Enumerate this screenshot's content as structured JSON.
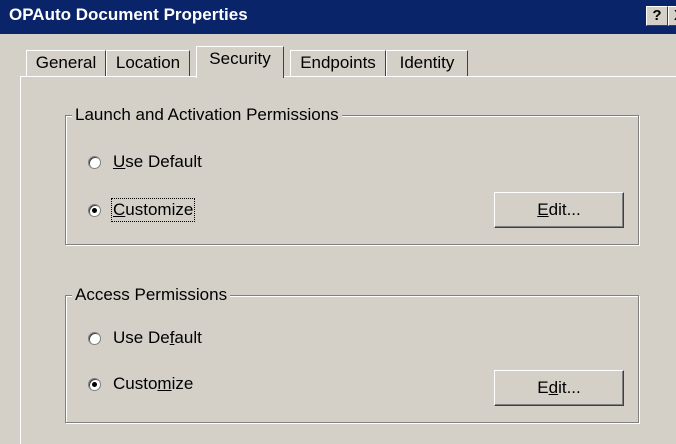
{
  "window": {
    "title": "OPAuto Document Properties",
    "help_glyph": "?",
    "close_glyph": "X"
  },
  "tabs": [
    {
      "label": "General"
    },
    {
      "label": "Location"
    },
    {
      "label": "Security",
      "active": true
    },
    {
      "label": "Endpoints"
    },
    {
      "label": "Identity"
    }
  ],
  "launch_group": {
    "title": "Launch and Activation Permissions",
    "use_default": {
      "pre": "",
      "accel": "U",
      "post": "se Default",
      "checked": false
    },
    "customize": {
      "pre": "",
      "accel": "C",
      "post": "ustomize",
      "checked": true
    },
    "edit_button": {
      "pre": "",
      "accel": "E",
      "post": "dit..."
    }
  },
  "access_group": {
    "title": "Access Permissions",
    "use_default": {
      "pre": "Use De",
      "accel": "f",
      "post": "ault",
      "checked": false
    },
    "customize": {
      "pre": "Custo",
      "accel": "m",
      "post": "ize",
      "checked": true
    },
    "edit_button": {
      "pre": "E",
      "accel": "d",
      "post": "it..."
    }
  }
}
